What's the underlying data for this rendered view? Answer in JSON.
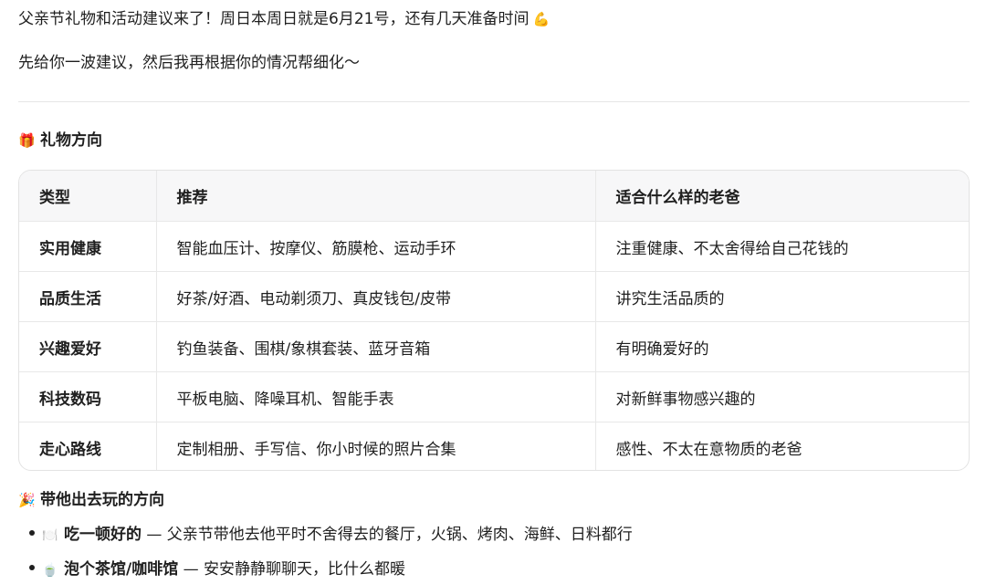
{
  "intro": {
    "line1": "父亲节礼物和活动建议来了！周日本周日就是6月21号，还有几天准备时间",
    "line1_emoji": "💪",
    "line2": "先给你一波建议，然后我再根据你的情况帮细化～"
  },
  "gift_section": {
    "icon": "🎁",
    "title": "礼物方向",
    "headers": [
      "类型",
      "推荐",
      "适合什么样的老爸"
    ],
    "rows": [
      {
        "type": "实用健康",
        "rec": "智能血压计、按摩仪、筋膜枪、运动手环",
        "fit": "注重健康、不太舍得给自己花钱的"
      },
      {
        "type": "品质生活",
        "rec": "好茶/好酒、电动剃须刀、真皮钱包/皮带",
        "fit": "讲究生活品质的"
      },
      {
        "type": "兴趣爱好",
        "rec": "钓鱼装备、围棋/象棋套装、蓝牙音箱",
        "fit": "有明确爱好的"
      },
      {
        "type": "科技数码",
        "rec": "平板电脑、降噪耳机、智能手表",
        "fit": "对新鲜事物感兴趣的"
      },
      {
        "type": "走心路线",
        "rec": "定制相册、手写信、你小时候的照片合集",
        "fit": "感性、不太在意物质的老爸"
      }
    ]
  },
  "outing_section": {
    "icon": "🎉",
    "title": "带他出去玩的方向",
    "items": [
      {
        "icon": "🍽️",
        "strong": "吃一顿好的",
        "rest": " — 父亲节带他去他平时不舍得去的餐厅，火锅、烤肉、海鲜、日料都行"
      },
      {
        "icon": "🍵",
        "strong": "泡个茶馆/咖啡馆",
        "rest": " — 安安静静聊聊天，比什么都暖"
      }
    ]
  }
}
